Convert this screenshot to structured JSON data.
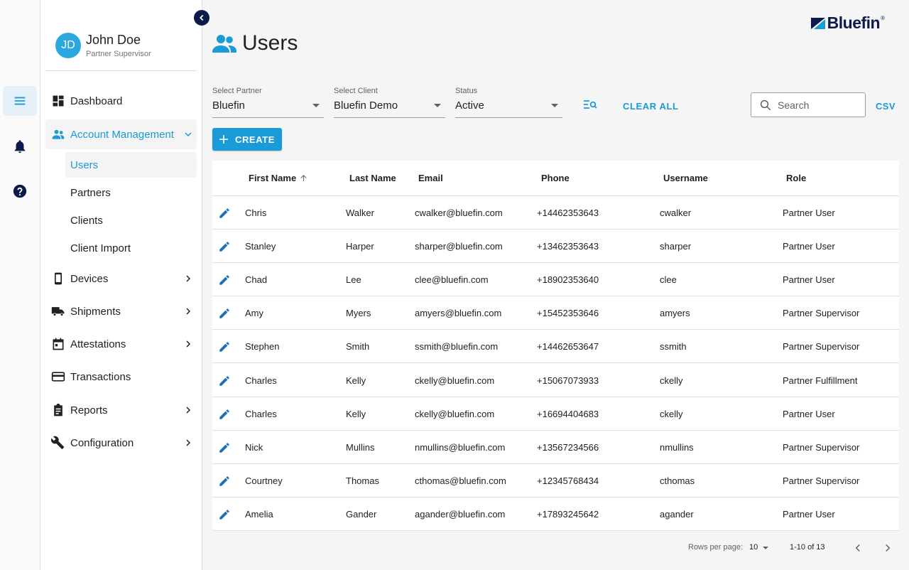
{
  "colors": {
    "accent": "#1a9bd7",
    "navy": "#0d1b4c",
    "avatar": "#29a8e0"
  },
  "brand": {
    "name": "Bluefin",
    "reg": "®"
  },
  "rail": {
    "icons": [
      "menu-icon",
      "bell-icon",
      "help-icon"
    ]
  },
  "profile": {
    "initials": "JD",
    "name": "John Doe",
    "role": "Partner Supervisor"
  },
  "nav": {
    "dashboard": "Dashboard",
    "account_management": "Account Management",
    "sub": {
      "users": "Users",
      "partners": "Partners",
      "clients": "Clients",
      "client_import": "Client Import"
    },
    "devices": "Devices",
    "shipments": "Shipments",
    "attestations": "Attestations",
    "transactions": "Transactions",
    "reports": "Reports",
    "configuration": "Configuration"
  },
  "page": {
    "title": "Users"
  },
  "filters": {
    "partner": {
      "label": "Select Partner",
      "value": "Bluefin"
    },
    "client": {
      "label": "Select Client",
      "value": "Bluefin Demo"
    },
    "status": {
      "label": "Status",
      "value": "Active"
    },
    "clear_all": "CLEAR ALL",
    "search_placeholder": "Search",
    "csv": "CSV"
  },
  "create_label": "CREATE",
  "table": {
    "columns": {
      "first_name": "First Name",
      "last_name": "Last Name",
      "email": "Email",
      "phone": "Phone",
      "username": "Username",
      "role": "Role"
    },
    "sort": {
      "column": "First Name",
      "direction": "ascending"
    },
    "rows": [
      {
        "first": "Chris",
        "last": "Walker",
        "email": "cwalker@bluefin.com",
        "phone": "+14462353643",
        "username": "cwalker",
        "role": "Partner User"
      },
      {
        "first": "Stanley",
        "last": "Harper",
        "email": "sharper@bluefin.com",
        "phone": "+13462353643",
        "username": "sharper",
        "role": "Partner User"
      },
      {
        "first": "Chad",
        "last": "Lee",
        "email": "clee@bluefin.com",
        "phone": "+18902353640",
        "username": "clee",
        "role": "Partner User"
      },
      {
        "first": "Amy",
        "last": "Myers",
        "email": "amyers@bluefin.com",
        "phone": "+15452353646",
        "username": "amyers",
        "role": "Partner Supervisor"
      },
      {
        "first": "Stephen",
        "last": "Smith",
        "email": "ssmith@bluefin.com",
        "phone": "+14462653647",
        "username": "ssmith",
        "role": "Partner Supervisor"
      },
      {
        "first": "Charles",
        "last": "Kelly",
        "email": "ckelly@bluefin.com",
        "phone": "+15067073933",
        "username": "ckelly",
        "role": "Partner Fulfillment"
      },
      {
        "first": "Charles",
        "last": "Kelly",
        "email": "ckelly@bluefin.com",
        "phone": "+16694404683",
        "username": "ckelly",
        "role": "Partner User"
      },
      {
        "first": "Nick",
        "last": "Mullins",
        "email": "nmullins@bluefin.com",
        "phone": "+13567234566",
        "username": "nmullins",
        "role": "Partner Supervisor"
      },
      {
        "first": "Courtney",
        "last": "Thomas",
        "email": "cthomas@bluefin.com",
        "phone": "+12345768434",
        "username": "cthomas",
        "role": "Partner Supervisor"
      },
      {
        "first": "Amelia",
        "last": "Gander",
        "email": "agander@bluefin.com",
        "phone": "+17893245642",
        "username": "agander",
        "role": "Partner User"
      }
    ]
  },
  "pagination": {
    "rows_per_page_label": "Rows per page:",
    "rows_per_page": "10",
    "range": "1-10 of 13"
  }
}
